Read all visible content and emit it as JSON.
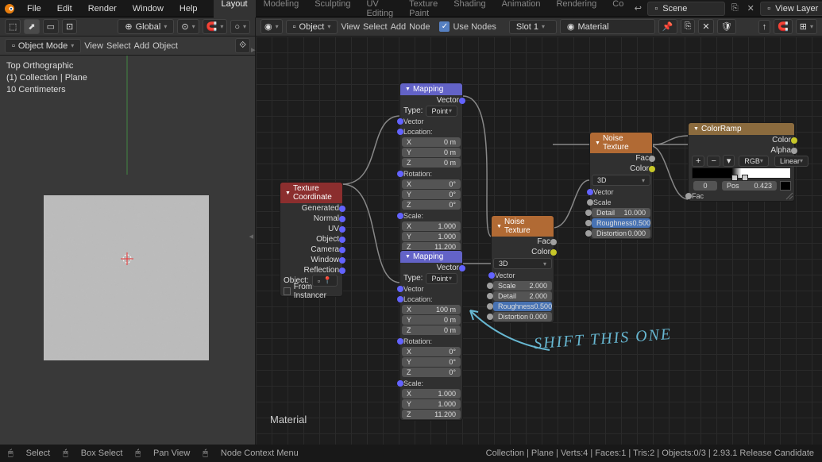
{
  "menubar": {
    "items": [
      "File",
      "Edit",
      "Render",
      "Window",
      "Help"
    ],
    "tabs": [
      "Layout",
      "Modeling",
      "Sculpting",
      "UV Editing",
      "Texture Paint",
      "Shading",
      "Animation",
      "Rendering",
      "Co"
    ],
    "active_tab": 0,
    "scene": "Scene",
    "view_layer": "View Layer"
  },
  "viewport": {
    "header": {
      "mode": "Object Mode",
      "menus": [
        "View",
        "Select",
        "Add",
        "Object"
      ],
      "orientation": "Global"
    },
    "info": {
      "line1": "Top Orthographic",
      "line2": "(1) Collection | Plane",
      "line3": "10 Centimeters"
    }
  },
  "node_editor": {
    "header": {
      "mode": "Object",
      "menus": [
        "View",
        "Select",
        "Add",
        "Node"
      ],
      "use_nodes": "Use Nodes",
      "slot": "Slot 1",
      "material": "Material"
    },
    "material_label": "Material"
  },
  "nodes": {
    "tex_coord": {
      "title": "Texture Coordinate",
      "outputs": [
        "Generated",
        "Normal",
        "UV",
        "Object",
        "Camera",
        "Window",
        "Reflection"
      ],
      "object_label": "Object:",
      "from_instancer": "From Instancer"
    },
    "mapping1": {
      "title": "Mapping",
      "out_vector": "Vector",
      "type_label": "Type:",
      "type_value": "Point",
      "vector_label": "Vector",
      "loc_label": "Location:",
      "loc": {
        "x_lbl": "X",
        "x": "0 m",
        "y_lbl": "Y",
        "y": "0 m",
        "z_lbl": "Z",
        "z": "0 m"
      },
      "rot_label": "Rotation:",
      "rot": {
        "x_lbl": "X",
        "x": "0°",
        "y_lbl": "Y",
        "y": "0°",
        "z_lbl": "Z",
        "z": "0°"
      },
      "scale_label": "Scale:",
      "scale": {
        "x_lbl": "X",
        "x": "1.000",
        "y_lbl": "Y",
        "y": "1.000",
        "z_lbl": "Z",
        "z": "11.200"
      }
    },
    "mapping2": {
      "title": "Mapping",
      "out_vector": "Vector",
      "type_label": "Type:",
      "type_value": "Point",
      "vector_label": "Vector",
      "loc_label": "Location:",
      "loc": {
        "x_lbl": "X",
        "x": "100 m",
        "y_lbl": "Y",
        "y": "0 m",
        "z_lbl": "Z",
        "z": "0 m"
      },
      "rot_label": "Rotation:",
      "rot": {
        "x_lbl": "X",
        "x": "0°",
        "y_lbl": "Y",
        "y": "0°",
        "z_lbl": "Z",
        "z": "0°"
      },
      "scale_label": "Scale:",
      "scale": {
        "x_lbl": "X",
        "x": "1.000",
        "y_lbl": "Y",
        "y": "1.000",
        "z_lbl": "Z",
        "z": "11.200"
      }
    },
    "noise1": {
      "title": "Noise Texture",
      "out_fac": "Fac",
      "out_color": "Color",
      "dim": "3D",
      "vector": "Vector",
      "scale_lbl": "Scale",
      "scale": "2.000",
      "detail_lbl": "Detail",
      "detail": "2.000",
      "rough_lbl": "Roughness",
      "rough": "0.500",
      "dist_lbl": "Distortion",
      "dist": "0.000"
    },
    "noise2": {
      "title": "Noise Texture",
      "out_fac": "Fac",
      "out_color": "Color",
      "dim": "3D",
      "vector": "Vector",
      "scale_lbl": "Scale",
      "detail_lbl": "Detail",
      "detail": "10.000",
      "rough_lbl": "Roughness",
      "rough": "0.500",
      "dist_lbl": "Distortion",
      "dist": "0.000"
    },
    "colorramp": {
      "title": "ColorRamp",
      "out_color": "Color",
      "out_alpha": "Alpha",
      "mode": "RGB",
      "interp": "Linear",
      "pos_field_lbl": "0",
      "pos_lbl": "Pos",
      "pos": "0.423",
      "fac": "Fac"
    }
  },
  "annotation": {
    "text": "SHIFT THIS ONE"
  },
  "statusbar": {
    "select": "Select",
    "box_select": "Box Select",
    "pan_view": "Pan View",
    "context_menu": "Node Context Menu",
    "right": "Collection | Plane | Verts:4 | Faces:1 | Tris:2 | Objects:0/3 | 2.93.1 Release Candidate"
  }
}
